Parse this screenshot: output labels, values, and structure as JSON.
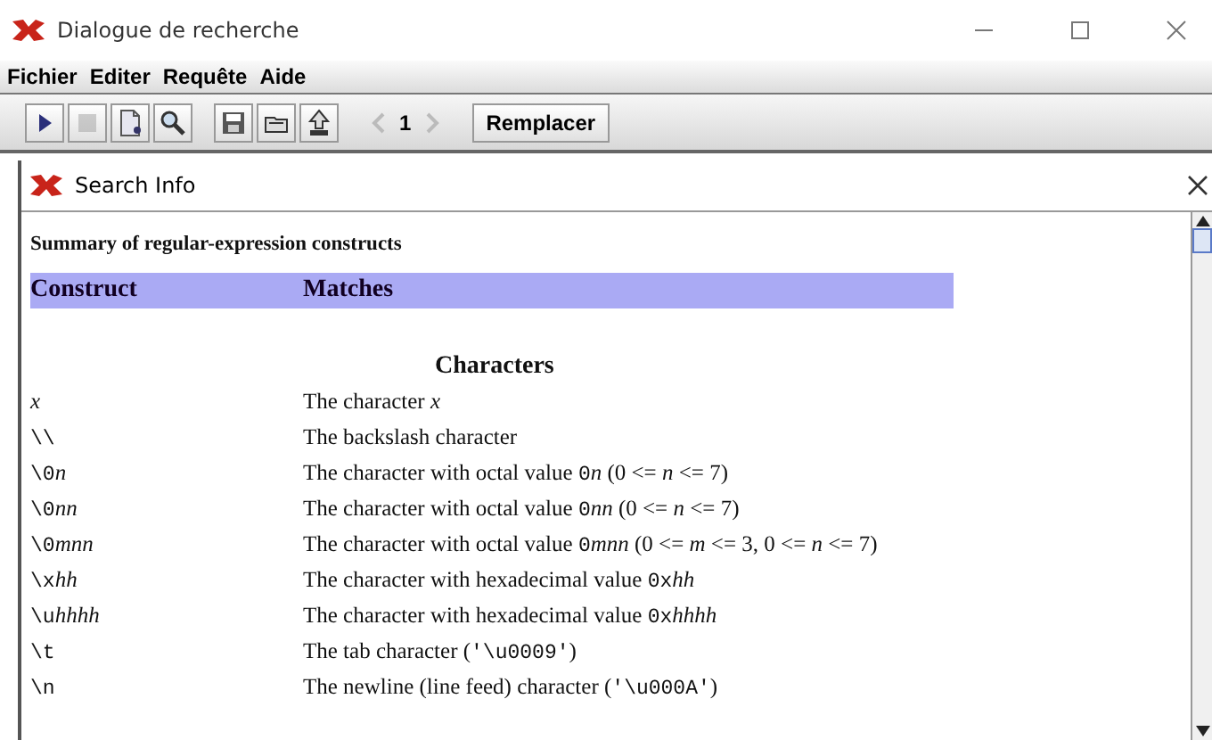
{
  "window": {
    "title": "Dialogue de recherche"
  },
  "menu": [
    "Fichier",
    "Editer",
    "Requête",
    "Aide"
  ],
  "toolbar": [
    {
      "kind": "play",
      "disabled": false
    },
    {
      "kind": "stop",
      "disabled": true
    },
    {
      "kind": "new",
      "disabled": false
    },
    {
      "kind": "search",
      "disabled": false
    },
    {
      "kind": "sep"
    },
    {
      "kind": "save",
      "disabled": false
    },
    {
      "kind": "open",
      "disabled": false
    },
    {
      "kind": "upload",
      "disabled": false
    },
    {
      "kind": "sep"
    },
    {
      "kind": "prev",
      "disabled": true
    },
    {
      "kind": "page",
      "label": "1"
    },
    {
      "kind": "next",
      "disabled": true
    },
    {
      "kind": "sep"
    },
    {
      "kind": "text",
      "label": "Remplacer"
    }
  ],
  "panel": {
    "title": "Search Info"
  },
  "doc": {
    "summary": "Summary of regular-expression constructs",
    "columns": [
      "Construct",
      "Matches"
    ],
    "section": "Characters",
    "rows": [
      {
        "construct": [
          {
            "kind": "var",
            "text": "x"
          }
        ],
        "matches": [
          {
            "kind": "plain",
            "text": "The character "
          },
          {
            "kind": "var",
            "text": "x"
          }
        ]
      },
      {
        "construct": [
          {
            "kind": "code",
            "text": "\\\\"
          }
        ],
        "matches": [
          {
            "kind": "plain",
            "text": "The backslash character"
          }
        ]
      },
      {
        "construct": [
          {
            "kind": "code",
            "text": "\\0"
          },
          {
            "kind": "var",
            "text": "n"
          }
        ],
        "matches": [
          {
            "kind": "plain",
            "text": "The character with octal value "
          },
          {
            "kind": "code",
            "text": "0"
          },
          {
            "kind": "var",
            "text": "n"
          },
          {
            "kind": "plain",
            "text": " (0 <= "
          },
          {
            "kind": "var",
            "text": "n"
          },
          {
            "kind": "plain",
            "text": " <= 7)"
          }
        ]
      },
      {
        "construct": [
          {
            "kind": "code",
            "text": "\\0"
          },
          {
            "kind": "var",
            "text": "nn"
          }
        ],
        "matches": [
          {
            "kind": "plain",
            "text": "The character with octal value "
          },
          {
            "kind": "code",
            "text": "0"
          },
          {
            "kind": "var",
            "text": "nn"
          },
          {
            "kind": "plain",
            "text": " (0 <= "
          },
          {
            "kind": "var",
            "text": "n"
          },
          {
            "kind": "plain",
            "text": " <= 7)"
          }
        ]
      },
      {
        "construct": [
          {
            "kind": "code",
            "text": "\\0"
          },
          {
            "kind": "var",
            "text": "mnn"
          }
        ],
        "matches": [
          {
            "kind": "plain",
            "text": "The character with octal value "
          },
          {
            "kind": "code",
            "text": "0"
          },
          {
            "kind": "var",
            "text": "mnn"
          },
          {
            "kind": "plain",
            "text": " (0 <= "
          },
          {
            "kind": "var",
            "text": "m"
          },
          {
            "kind": "plain",
            "text": " <= 3, 0 <= "
          },
          {
            "kind": "var",
            "text": "n"
          },
          {
            "kind": "plain",
            "text": " <= 7)"
          }
        ]
      },
      {
        "construct": [
          {
            "kind": "code",
            "text": "\\x"
          },
          {
            "kind": "var",
            "text": "hh"
          }
        ],
        "matches": [
          {
            "kind": "plain",
            "text": "The character with hexadecimal value "
          },
          {
            "kind": "code",
            "text": "0x"
          },
          {
            "kind": "var",
            "text": "hh"
          }
        ]
      },
      {
        "construct": [
          {
            "kind": "code",
            "text": "\\u"
          },
          {
            "kind": "var",
            "text": "hhhh"
          }
        ],
        "matches": [
          {
            "kind": "plain",
            "text": "The character with hexadecimal value "
          },
          {
            "kind": "code",
            "text": "0x"
          },
          {
            "kind": "var",
            "text": "hhhh"
          }
        ]
      },
      {
        "construct": [
          {
            "kind": "code",
            "text": "\\t"
          }
        ],
        "matches": [
          {
            "kind": "plain",
            "text": "The tab character ("
          },
          {
            "kind": "code",
            "text": "'\\u0009'"
          },
          {
            "kind": "plain",
            "text": ")"
          }
        ]
      },
      {
        "construct": [
          {
            "kind": "code",
            "text": "\\n"
          }
        ],
        "matches": [
          {
            "kind": "plain",
            "text": "The newline (line feed) character ("
          },
          {
            "kind": "code",
            "text": "'\\u000A'"
          },
          {
            "kind": "plain",
            "text": ")"
          }
        ]
      }
    ]
  }
}
